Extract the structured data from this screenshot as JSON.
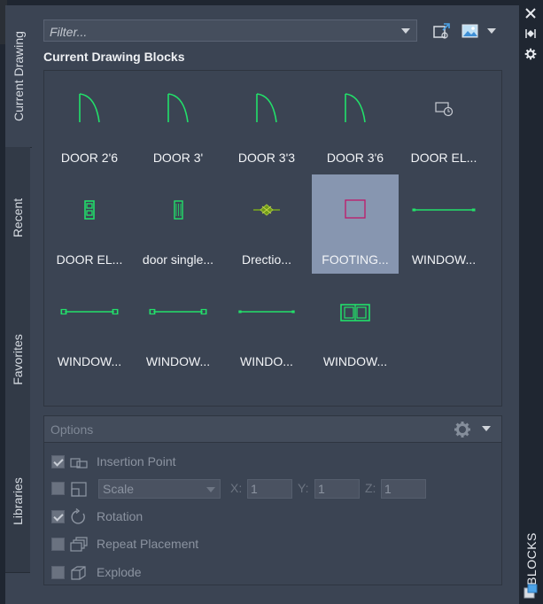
{
  "palette": {
    "title": "BLOCKS"
  },
  "tabs": [
    {
      "label": "Current Drawing",
      "active": true
    },
    {
      "label": "Recent",
      "active": false
    },
    {
      "label": "Favorites",
      "active": false
    },
    {
      "label": "Libraries",
      "active": false
    }
  ],
  "filter": {
    "placeholder": "Filter...",
    "value": ""
  },
  "section_title": "Current Drawing Blocks",
  "blocks": [
    {
      "label": "DOOR 2'6",
      "icon": "door-swing-icon",
      "selected": false
    },
    {
      "label": "DOOR 3'",
      "icon": "door-swing-icon",
      "selected": false
    },
    {
      "label": "DOOR 3'3",
      "icon": "door-swing-icon",
      "selected": false
    },
    {
      "label": "DOOR 3'6",
      "icon": "door-swing-icon",
      "selected": false
    },
    {
      "label": "DOOR EL...",
      "icon": "door-elevation-icon",
      "selected": false
    },
    {
      "label": "DOOR EL...",
      "icon": "door-panel-icon",
      "selected": false
    },
    {
      "label": "door single...",
      "icon": "door-single-icon",
      "selected": false
    },
    {
      "label": "Drectio...",
      "icon": "direction-icon",
      "selected": false
    },
    {
      "label": "FOOTING...",
      "icon": "footing-icon",
      "selected": true
    },
    {
      "label": "WINDOW...",
      "icon": "window-line-icon",
      "selected": false
    },
    {
      "label": "WINDOW...",
      "icon": "window-icon",
      "selected": false
    },
    {
      "label": "WINDOW...",
      "icon": "window-icon",
      "selected": false
    },
    {
      "label": "WINDO...",
      "icon": "window-line-icon",
      "selected": false
    },
    {
      "label": "WINDOW...",
      "icon": "window-double-icon",
      "selected": false
    }
  ],
  "options": {
    "title": "Options",
    "insertion_point": {
      "label": "Insertion Point",
      "checked": true
    },
    "scale": {
      "label": "Scale",
      "checked": false,
      "x_label": "X:",
      "y_label": "Y:",
      "z_label": "Z:",
      "x": "1",
      "y": "1",
      "z": "1"
    },
    "rotation": {
      "label": "Rotation",
      "checked": true
    },
    "repeat_placement": {
      "label": "Repeat Placement",
      "checked": false
    },
    "explode": {
      "label": "Explode",
      "checked": false
    }
  },
  "colors": {
    "accent_green": "#22e06a",
    "footing_magenta": "#c0186a",
    "selected_tile": "#8796b0"
  }
}
